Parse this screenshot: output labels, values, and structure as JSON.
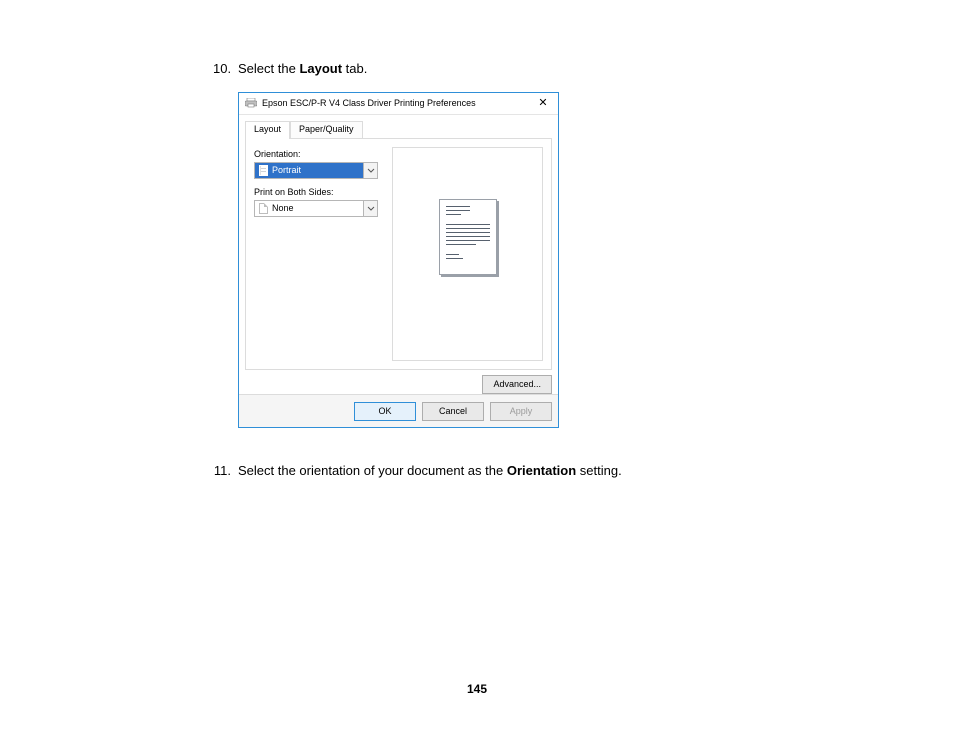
{
  "steps": {
    "s10": {
      "num": "10.",
      "pre": "Select the ",
      "bold": "Layout",
      "post": " tab."
    },
    "s11": {
      "num": "11.",
      "pre": "Select the orientation of your document as the ",
      "bold": "Orientation",
      "post": " setting."
    }
  },
  "dialog": {
    "title": "Epson ESC/P-R V4 Class Driver Printing Preferences",
    "close": "✕",
    "tabs": {
      "layout": "Layout",
      "paper_quality": "Paper/Quality"
    },
    "orientation_label": "Orientation:",
    "orientation_value": "Portrait",
    "both_sides_label": "Print on Both Sides:",
    "both_sides_value": "None",
    "advanced": "Advanced...",
    "buttons": {
      "ok": "OK",
      "cancel": "Cancel",
      "apply": "Apply"
    }
  },
  "page_number": "145"
}
